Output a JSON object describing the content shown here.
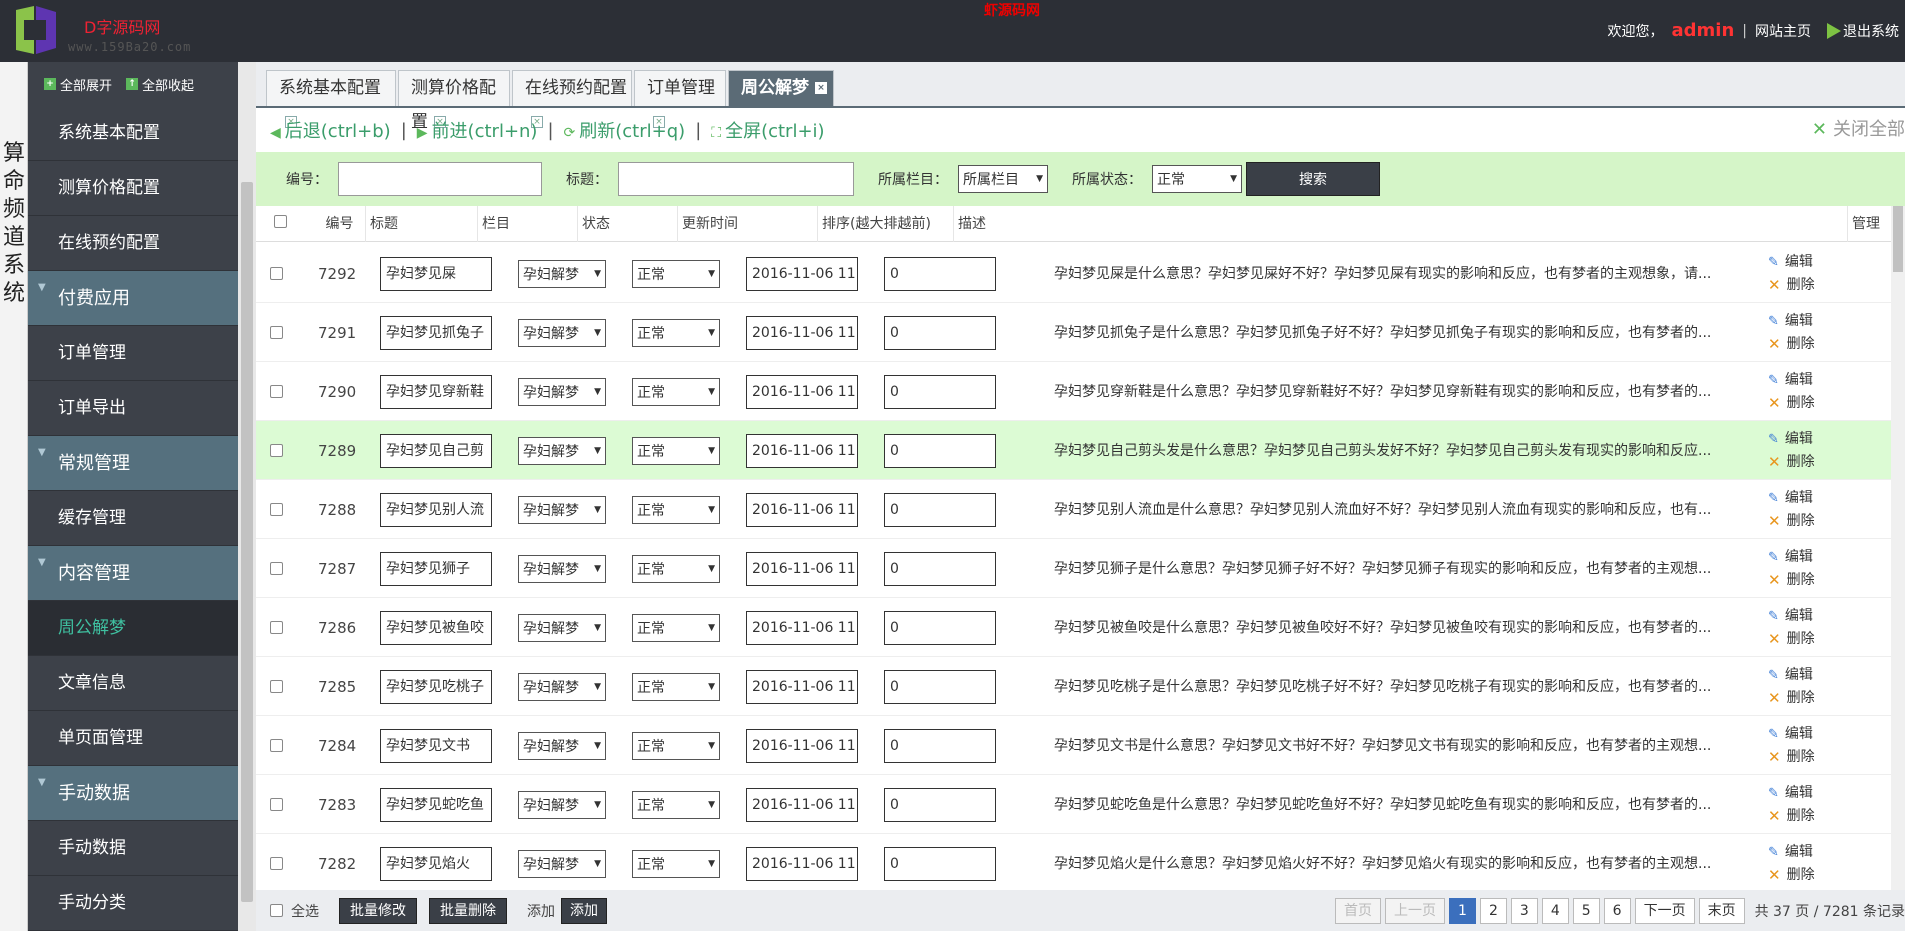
{
  "header": {
    "logo_text": "D字源码网",
    "logo_url": "www.159Ba20.com",
    "center_text": "虾源码网",
    "welcome": "欢迎您，",
    "username": "admin",
    "site_home": "网站主页",
    "logout": "退出系统"
  },
  "vstrip": {
    "text": "算命频道系统"
  },
  "sidebar": {
    "expand_all": "全部展开",
    "collapse_all": "全部收起",
    "items": [
      {
        "label": "系统基本配置",
        "type": "item"
      },
      {
        "label": "测算价格配置",
        "type": "item"
      },
      {
        "label": "在线预约配置",
        "type": "item"
      },
      {
        "label": "付费应用",
        "type": "group"
      },
      {
        "label": "订单管理",
        "type": "item"
      },
      {
        "label": "订单导出",
        "type": "item"
      },
      {
        "label": "常规管理",
        "type": "group"
      },
      {
        "label": "缓存管理",
        "type": "item"
      },
      {
        "label": "内容管理",
        "type": "group"
      },
      {
        "label": "周公解梦",
        "type": "active"
      },
      {
        "label": "文章信息",
        "type": "item"
      },
      {
        "label": "单页面管理",
        "type": "item"
      },
      {
        "label": "手动数据",
        "type": "group"
      },
      {
        "label": "手动数据",
        "type": "item"
      },
      {
        "label": "手动分类",
        "type": "item"
      }
    ]
  },
  "tabs": [
    "系统基本配置",
    "测算价格配置",
    "在线预约配置",
    "订单管理",
    "周公解梦"
  ],
  "nav": {
    "back": "后退(ctrl+b)",
    "forward": "前进(ctrl+n)",
    "refresh": "刷新(ctrl+q)",
    "fullscreen": "全屏(ctrl+i)",
    "close_all": "关闭全部"
  },
  "search": {
    "id_label": "编号：",
    "title_label": "标题：",
    "column_label": "所属栏目：",
    "column_value": "所属栏目",
    "status_label": "所属状态：",
    "status_value": "正常",
    "button": "搜索"
  },
  "table": {
    "headers": [
      "编号",
      "标题",
      "栏目",
      "状态",
      "更新时间",
      "排序(越大排越前)",
      "描述",
      "管理"
    ],
    "edit_label": "编辑",
    "delete_label": "删除",
    "rows": [
      {
        "id": "7292",
        "title": "孕妇梦见屎",
        "column": "孕妇解梦",
        "status": "正常",
        "time": "2016-11-06 11:",
        "sort": "0",
        "desc": "孕妇梦见屎是什么意思？孕妇梦见屎好不好？孕妇梦见屎有现实的影响和反应，也有梦者的主观想象，请..."
      },
      {
        "id": "7291",
        "title": "孕妇梦见抓兔子",
        "column": "孕妇解梦",
        "status": "正常",
        "time": "2016-11-06 11:",
        "sort": "0",
        "desc": "孕妇梦见抓兔子是什么意思？孕妇梦见抓兔子好不好？孕妇梦见抓兔子有现实的影响和反应，也有梦者的..."
      },
      {
        "id": "7290",
        "title": "孕妇梦见穿新鞋",
        "column": "孕妇解梦",
        "status": "正常",
        "time": "2016-11-06 11:",
        "sort": "0",
        "desc": "孕妇梦见穿新鞋是什么意思？孕妇梦见穿新鞋好不好？孕妇梦见穿新鞋有现实的影响和反应，也有梦者的..."
      },
      {
        "id": "7289",
        "title": "孕妇梦见自己剪",
        "column": "孕妇解梦",
        "status": "正常",
        "time": "2016-11-06 11:",
        "sort": "0",
        "desc": "孕妇梦见自己剪头发是什么意思？孕妇梦见自己剪头发好不好？孕妇梦见自己剪头发有现实的影响和反应..."
      },
      {
        "id": "7288",
        "title": "孕妇梦见别人流",
        "column": "孕妇解梦",
        "status": "正常",
        "time": "2016-11-06 11:",
        "sort": "0",
        "desc": "孕妇梦见别人流血是什么意思？孕妇梦见别人流血好不好？孕妇梦见别人流血有现实的影响和反应，也有..."
      },
      {
        "id": "7287",
        "title": "孕妇梦见狮子",
        "column": "孕妇解梦",
        "status": "正常",
        "time": "2016-11-06 11:",
        "sort": "0",
        "desc": "孕妇梦见狮子是什么意思？孕妇梦见狮子好不好？孕妇梦见狮子有现实的影响和反应，也有梦者的主观想..."
      },
      {
        "id": "7286",
        "title": "孕妇梦见被鱼咬",
        "column": "孕妇解梦",
        "status": "正常",
        "time": "2016-11-06 11:",
        "sort": "0",
        "desc": "孕妇梦见被鱼咬是什么意思？孕妇梦见被鱼咬好不好？孕妇梦见被鱼咬有现实的影响和反应，也有梦者的..."
      },
      {
        "id": "7285",
        "title": "孕妇梦见吃桃子",
        "column": "孕妇解梦",
        "status": "正常",
        "time": "2016-11-06 11:",
        "sort": "0",
        "desc": "孕妇梦见吃桃子是什么意思？孕妇梦见吃桃子好不好？孕妇梦见吃桃子有现实的影响和反应，也有梦者的..."
      },
      {
        "id": "7284",
        "title": "孕妇梦见文书",
        "column": "孕妇解梦",
        "status": "正常",
        "time": "2016-11-06 11:",
        "sort": "0",
        "desc": "孕妇梦见文书是什么意思？孕妇梦见文书好不好？孕妇梦见文书有现实的影响和反应，也有梦者的主观想..."
      },
      {
        "id": "7283",
        "title": "孕妇梦见蛇吃鱼",
        "column": "孕妇解梦",
        "status": "正常",
        "time": "2016-11-06 11:",
        "sort": "0",
        "desc": "孕妇梦见蛇吃鱼是什么意思？孕妇梦见蛇吃鱼好不好？孕妇梦见蛇吃鱼有现实的影响和反应，也有梦者的..."
      },
      {
        "id": "7282",
        "title": "孕妇梦见焰火",
        "column": "孕妇解梦",
        "status": "正常",
        "time": "2016-11-06 11:",
        "sort": "0",
        "desc": "孕妇梦见焰火是什么意思？孕妇梦见焰火好不好？孕妇梦见焰火有现实的影响和反应，也有梦者的主观想..."
      }
    ]
  },
  "footer": {
    "select_all": "全选",
    "batch_edit": "批量修改",
    "batch_delete": "批量删除",
    "add_text": "添加",
    "add_button": "添加",
    "first": "首页",
    "prev": "上一页",
    "pages": [
      "1",
      "2",
      "3",
      "4",
      "5",
      "6"
    ],
    "next": "下一页",
    "last": "末页",
    "summary": "共 37 页 / 7281 条记录"
  },
  "colors": {
    "header_bg": "#2c2f36",
    "sidebar_bg": "#3d4149",
    "group_bg": "#55707e",
    "highlight_row": "#dcfbd4",
    "search_bg": "#d5f5c8",
    "accent_green": "#3b9d6b"
  }
}
